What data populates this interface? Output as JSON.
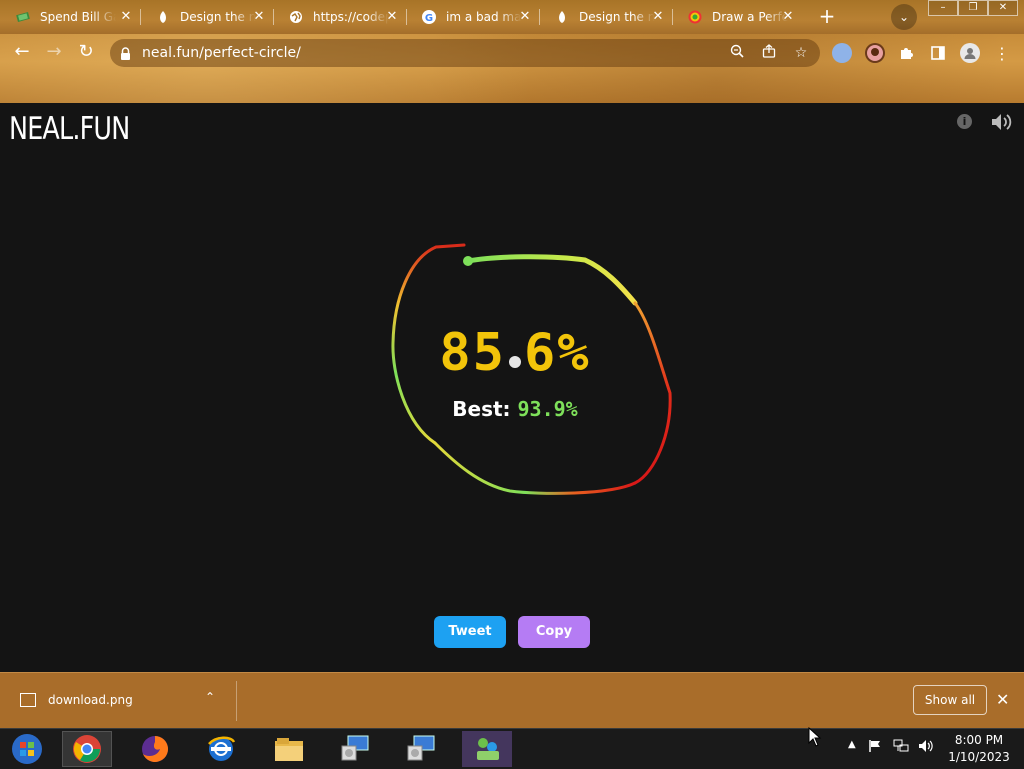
{
  "browser": {
    "tabs": [
      {
        "title": "Spend Bill Gates' Money",
        "icon": "money-icon"
      },
      {
        "title": "Design the next iPhone",
        "icon": "figure-icon"
      },
      {
        "title": "https://codepen.io",
        "icon": "globe-icon"
      },
      {
        "title": "im a bad man",
        "icon": "google-icon"
      },
      {
        "title": "Design the next iPhone",
        "icon": "figure-icon"
      },
      {
        "title": "Draw a Perfect Circle",
        "icon": "chrome-target-icon"
      }
    ],
    "tab_close_glyph": "✕",
    "new_tab_glyph": "+",
    "url": "neal.fun/perfect-circle/",
    "window_buttons": [
      "–",
      "❐",
      "✕"
    ]
  },
  "page": {
    "logo": "NEAL.FUN",
    "score_int": "85",
    "score_frac": "6%",
    "best_label": "Best:",
    "best_value": "93.9%",
    "tweet_label": "Tweet",
    "copy_label": "Copy",
    "colors": {
      "score": "#f2c40a",
      "best": "#7ee05a",
      "tweet": "#1da1f2",
      "copy": "#b57cf4"
    }
  },
  "downloads": {
    "file_name": "download.png",
    "show_all": "Show all"
  },
  "taskbar": {
    "apps": [
      "start-orb-icon",
      "chrome-icon",
      "firefox-icon",
      "ie-icon",
      "file-explorer-icon",
      "installer-icon",
      "installer-icon",
      "network-app-icon"
    ],
    "time": "8:00 PM",
    "date": "1/10/2023"
  }
}
